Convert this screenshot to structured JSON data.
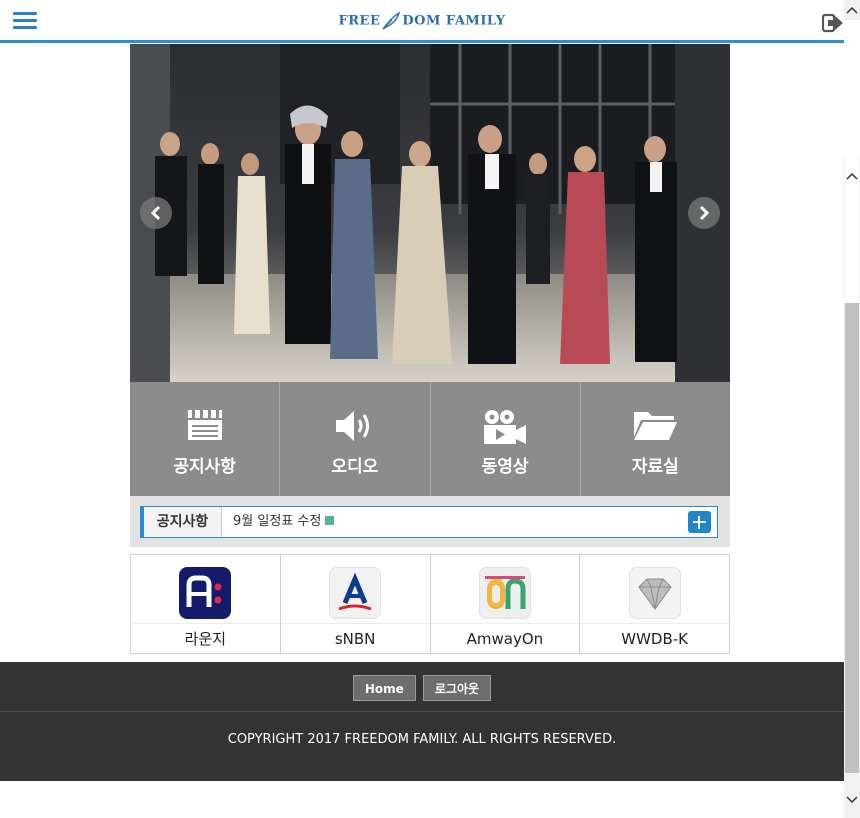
{
  "header": {
    "logo_text_left": "FREE",
    "logo_text_right": "DOM FAMILY",
    "menu_icon": "hamburger-menu-icon",
    "logout_icon": "logout-icon"
  },
  "hero": {
    "prev_icon": "chevron-left-icon",
    "next_icon": "chevron-right-icon"
  },
  "tiles": [
    {
      "label": "공지사항",
      "icon": "clapperboard-icon"
    },
    {
      "label": "오디오",
      "icon": "speaker-icon"
    },
    {
      "label": "동영상",
      "icon": "video-camera-icon"
    },
    {
      "label": "자료실",
      "icon": "folder-icon"
    }
  ],
  "notice": {
    "label": "공지사항",
    "text": "9월 일정표 수정",
    "badge_icon": "new-badge-icon",
    "more_icon": "plus-icon"
  },
  "apps": [
    {
      "label": "라운지",
      "icon": "lounge-app-icon"
    },
    {
      "label": "sNBN",
      "icon": "snbn-app-icon"
    },
    {
      "label": "AmwayOn",
      "icon": "amwayon-app-icon"
    },
    {
      "label": "WWDB-K",
      "icon": "wwdbk-app-icon"
    }
  ],
  "footer": {
    "home_label": "Home",
    "logout_label": "로그아웃",
    "copyright": "COPYRIGHT 2017 FREEDOM FAMILY. ALL RIGHTS RESERVED."
  },
  "colors": {
    "accent": "#2a8ad0",
    "tile_bg": "#8c8c8c",
    "footer_bg": "#333333"
  }
}
